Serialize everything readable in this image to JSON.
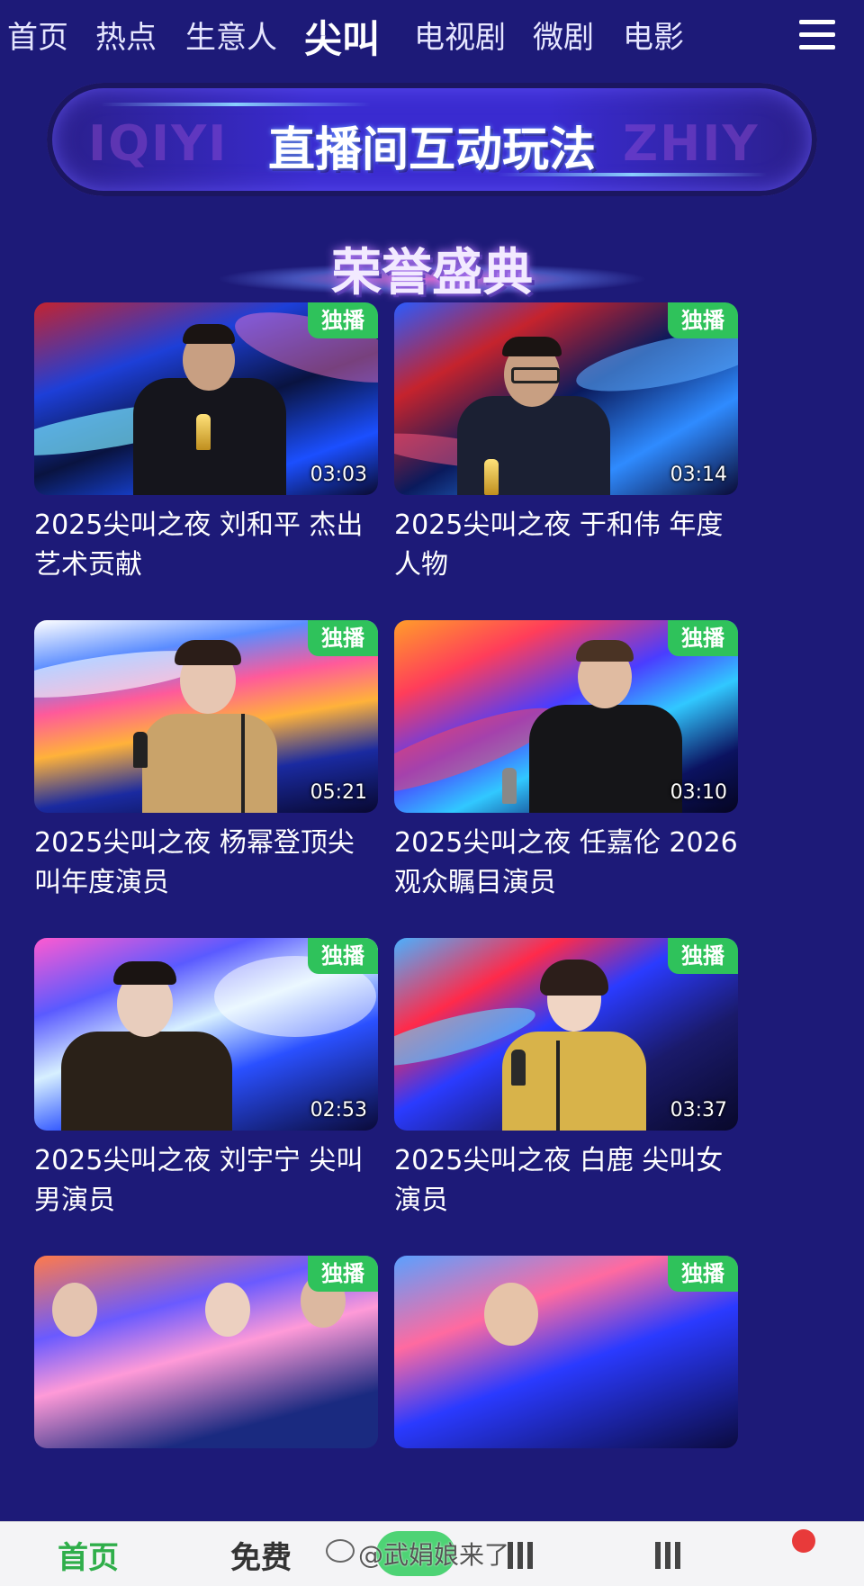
{
  "top_nav": {
    "tabs": [
      {
        "label": "首页",
        "active": false
      },
      {
        "label": "热点",
        "active": false
      },
      {
        "label": "生意人",
        "active": false
      },
      {
        "label": "尖叫",
        "active": true
      },
      {
        "label": "电视剧",
        "active": false
      },
      {
        "label": "微剧",
        "active": false
      },
      {
        "label": "电影",
        "active": false
      }
    ],
    "menu_icon": "hamburger-menu-icon"
  },
  "banner": {
    "title": "直播间互动玩法",
    "bg_left": "IQIYI",
    "bg_right": "ZHIY"
  },
  "section": {
    "title": "荣誉盛典"
  },
  "videos": [
    {
      "badge": "独播",
      "duration": "03:03",
      "title": "2025尖叫之夜 刘和平 杰出艺术贡献"
    },
    {
      "badge": "独播",
      "duration": "03:14",
      "title": "2025尖叫之夜 于和伟 年度人物"
    },
    {
      "badge": "独播",
      "duration": "05:21",
      "title": "2025尖叫之夜 杨幂登顶尖叫年度演员"
    },
    {
      "badge": "独播",
      "duration": "03:10",
      "title": "2025尖叫之夜 任嘉伦 2026观众瞩目演员"
    },
    {
      "badge": "独播",
      "duration": "02:53",
      "title": "2025尖叫之夜 刘宇宁 尖叫男演员"
    },
    {
      "badge": "独播",
      "duration": "03:37",
      "title": "2025尖叫之夜 白鹿 尖叫女演员"
    },
    {
      "badge": "独播",
      "duration": "",
      "title": ""
    },
    {
      "badge": "独播",
      "duration": "",
      "title": ""
    }
  ],
  "bottom_nav": {
    "home": "首页",
    "free": "免费"
  },
  "watermark": "@武娟娘来了",
  "colors": {
    "background": "#1d1a78",
    "badge_green": "#2fc25b",
    "active_green": "#2fae4a"
  }
}
